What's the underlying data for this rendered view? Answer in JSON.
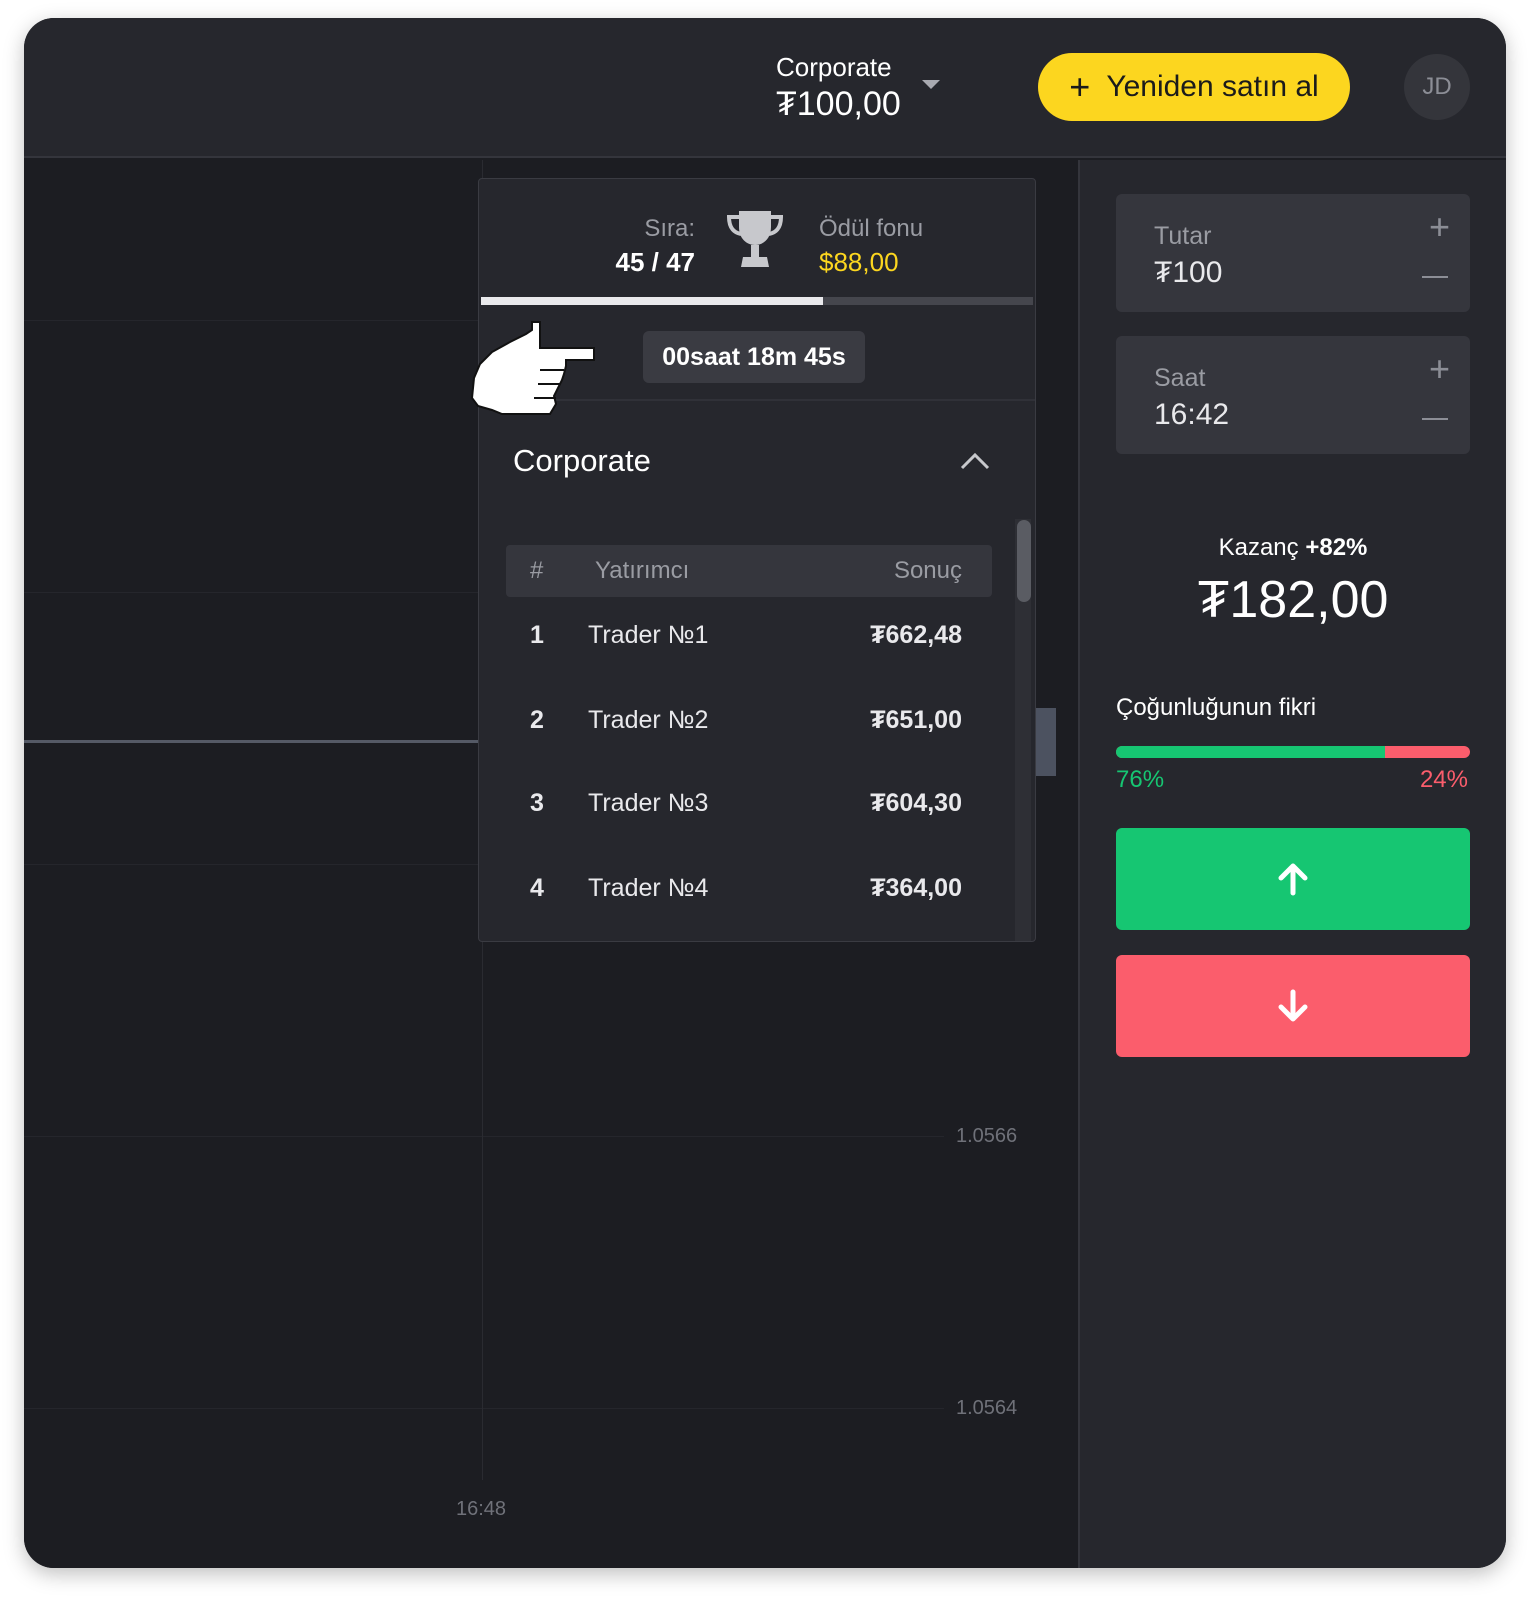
{
  "header": {
    "account_name": "Corporate",
    "account_balance": "₮100,00",
    "buy_label": "Yeniden satın al",
    "avatar_initials": "JD"
  },
  "tournament": {
    "rank_label": "Sıra:",
    "rank_value": "45 / 47",
    "prize_label": "Ödül fonu",
    "prize_value": "$88,00",
    "progress": 0.62,
    "timer": "00saat 18m 45s",
    "name": "Corporate",
    "table": {
      "headers": [
        "#",
        "Yatırımcı",
        "Sonuç"
      ],
      "rows": [
        {
          "rank": "1",
          "name": "Trader №1",
          "result": "₮662,48"
        },
        {
          "rank": "2",
          "name": "Trader №2",
          "result": "₮651,00"
        },
        {
          "rank": "3",
          "name": "Trader №3",
          "result": "₮604,30"
        },
        {
          "rank": "4",
          "name": "Trader №4",
          "result": "₮364,00"
        }
      ]
    }
  },
  "chart": {
    "price_labels": [
      "1.0566",
      "1.0564"
    ],
    "time_label": "16:48"
  },
  "trade": {
    "amount_label": "Tutar",
    "amount_value": "₮100",
    "time_label": "Saat",
    "time_value": "16:42",
    "profit_label": "Kazanç",
    "profit_percent": "+82%",
    "profit_value": "₮182,00",
    "opinion_title": "Çoğunluğunun fikri",
    "opinion_up": "76%",
    "opinion_down": "24%",
    "opinion_up_fraction": 0.76
  },
  "colors": {
    "accent_yellow": "#fcd61f",
    "up_green": "#16c672",
    "down_red": "#fb5d6c",
    "panel_bg": "#26272d",
    "chart_bg": "#1c1d22"
  },
  "icons": [
    "plus-icon",
    "caret-down-icon",
    "trophy-icon",
    "chevron-up-icon",
    "arrow-up-icon",
    "arrow-down-icon",
    "hand-pointer-icon"
  ]
}
